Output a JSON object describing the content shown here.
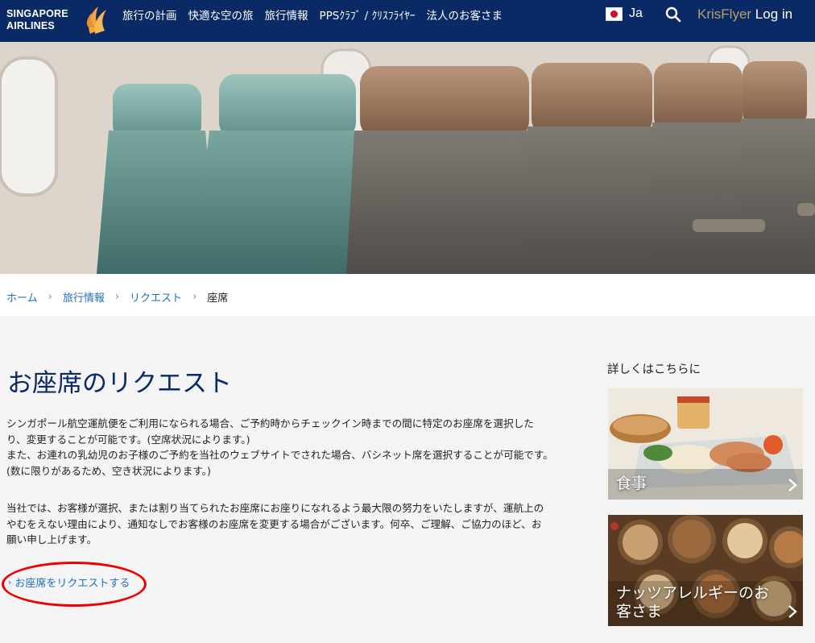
{
  "header": {
    "logo_lines": [
      "SINGAPORE",
      "AIRLINES"
    ],
    "nav": [
      "旅行の計画",
      "快適な空の旅",
      "旅行情報",
      "PPSｸﾗﾌﾞ / ｸﾘｽﾌﾗｲﾔｰ",
      "法人のお客さま"
    ],
    "language": "Ja",
    "login_brand": "KrisFlyer",
    "login_label": "Log in"
  },
  "breadcrumb": {
    "items": [
      "ホーム",
      "旅行情報",
      "リクエスト"
    ],
    "current": "座席",
    "separator": "›"
  },
  "main": {
    "title": "お座席のリクエスト",
    "paragraph1": [
      "シンガポール航空運航便をご利用になられる場合、ご予約時からチェックイン時までの間に特定のお座席を選択した",
      "り、変更することが可能です。(空席状況によります。)",
      "また、お連れの乳幼児のお子様のご予約を当社のウェブサイトでされた場合、バシネット席を選択することが可能です。",
      "(数に限りがあるため、空き状況によります。)"
    ],
    "paragraph2": [
      "当社では、お客様が選択、または割り当てられたお座席にお座りになれるよう最大限の努力をいたしますが、運航上の",
      "やむをえない理由により、通知なしでお客様のお座席を変更する場合がございます。何卒、ご理解、ご協力のほど、お",
      "願い申し上げます。"
    ],
    "request_link": "お座席をリクエストする"
  },
  "sidebar": {
    "title": "詳しくはこちらに",
    "cards": [
      "食事",
      "ナッツアレルギーのお客さま"
    ]
  },
  "colors": {
    "header_bg": "#0a2a66",
    "link": "#1f6fbf",
    "title": "#0a2a66",
    "krisflyer": "#b89e6a",
    "annotation": "#e00000"
  },
  "icons": [
    "singapore-airlines-bird-logo",
    "japan-flag-icon",
    "search-icon",
    "chevron-right-icon"
  ]
}
